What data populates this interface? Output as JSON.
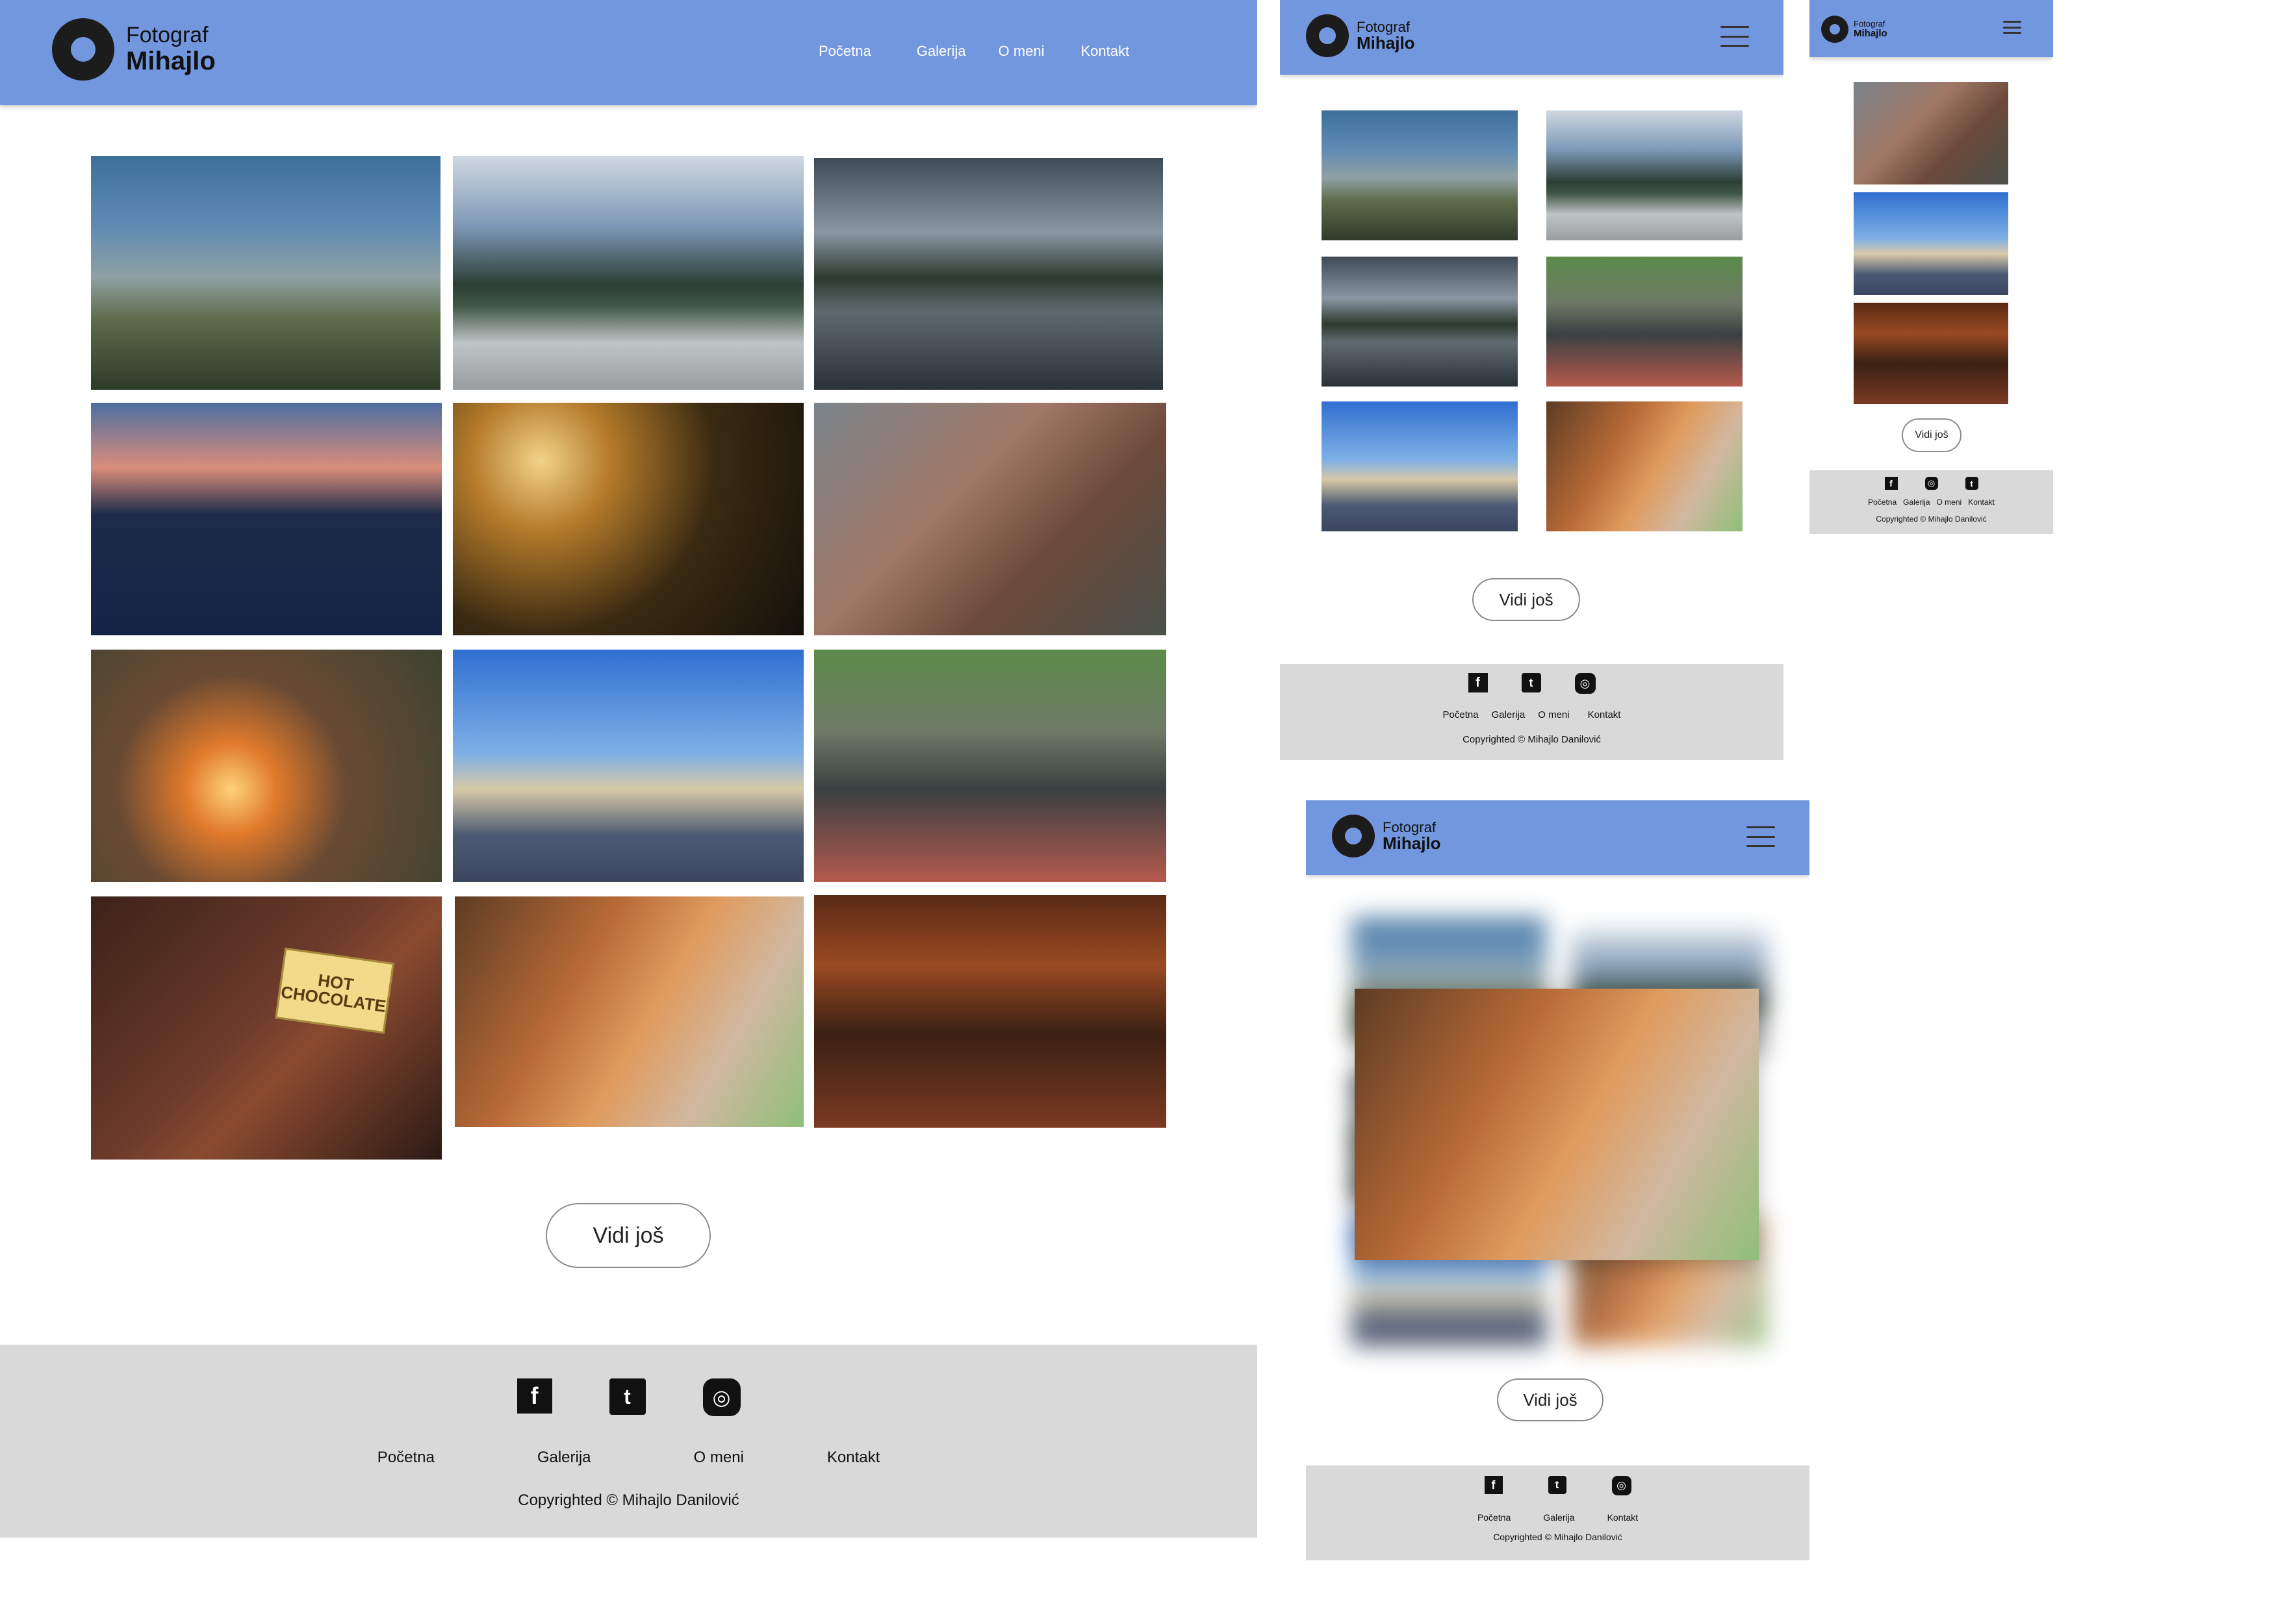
{
  "brand": {
    "line1": "Fotograf",
    "line2": "Mihajlo"
  },
  "nav": [
    "Početna",
    "Galerija",
    "O meni",
    "Kontakt"
  ],
  "photos": [
    {
      "icon": "binoculars-photo"
    },
    {
      "icon": "sunglasses-mountain-photo"
    },
    {
      "icon": "mountain-lake-photo"
    },
    {
      "icon": "dusk-lake-photo"
    },
    {
      "icon": "bokeh-leaves-photo"
    },
    {
      "icon": "kotor-bay-photo"
    },
    {
      "icon": "dog-campfire-photo"
    },
    {
      "icon": "tv-tower-photo"
    },
    {
      "icon": "bicycles-photo"
    },
    {
      "icon": "hot-chocolate-sign-photo"
    },
    {
      "icon": "horse-photo"
    },
    {
      "icon": "cafe-interior-photo"
    }
  ],
  "sign_text": "HOT CHOCOLATE",
  "button_label": "Vidi još",
  "footer": {
    "icons": [
      "facebook-icon",
      "twitter-icon",
      "instagram-icon"
    ],
    "links_desktop": [
      "Početna",
      "Galerija",
      "O meni",
      "Kontakt"
    ],
    "links_mobile_small": [
      "Početna",
      "Galerija",
      "O meni",
      "Kontakt"
    ],
    "links_tablet_lightbox": [
      "Početna",
      "Galerija",
      "Kontakt"
    ],
    "copyright": "Copyrighted © Mihajlo Danilović"
  },
  "colors": {
    "header": "#7397df",
    "footer": "#d9d9d9"
  }
}
